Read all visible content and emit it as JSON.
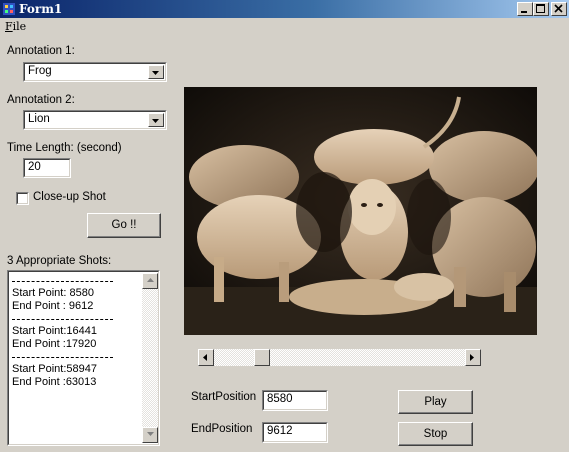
{
  "window": {
    "title": "Form1"
  },
  "menu": {
    "file_label": "File",
    "file_mnemonic": "F",
    "file_rest": "ile"
  },
  "annotation1": {
    "label": "Annotation 1:",
    "value": "Frog"
  },
  "annotation2": {
    "label": "Annotation 2:",
    "value": "Lion"
  },
  "time_length": {
    "label": "Time Length: (second)",
    "value": "20"
  },
  "closeup": {
    "label": "Close-up Shot",
    "checked": false
  },
  "go_button": {
    "label": "Go !!"
  },
  "shots": {
    "header": "3 Appropriate Shots:",
    "separator": "------------------------",
    "items": [
      {
        "start": "Start Point: 8580",
        "end": "End Point : 9612"
      },
      {
        "start": "Start Point:16441",
        "end": "End Point :17920"
      },
      {
        "start": "Start Point:58947",
        "end": "End Point :63013"
      }
    ]
  },
  "player": {
    "start_label": "StartPosition",
    "start_value": "8580",
    "end_label": "EndPosition",
    "end_value": "9612",
    "play_label": "Play",
    "stop_label": "Stop",
    "frame_description_icon": "video-frame-lions"
  },
  "slider": {
    "position_fraction": 0.17
  },
  "colors": {
    "face": "#d4d0c8",
    "titlebar_start": "#0a246a",
    "titlebar_end": "#a6caf0"
  }
}
